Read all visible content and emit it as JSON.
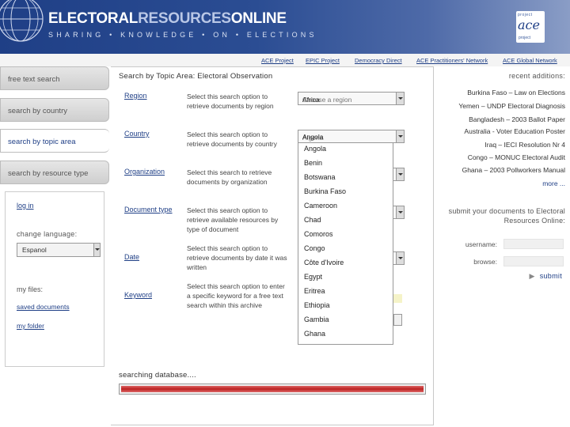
{
  "header": {
    "brand_part1": "ELECTORAL",
    "brand_part2": "RESOURCES",
    "brand_part3": "ONLINE",
    "tagline": "SHARING  •  KNOWLEDGE  •  ON  •  ELECTIONS",
    "logo_line1": "project",
    "logo_main": "ace",
    "logo_line3": "project"
  },
  "top_links": [
    "ACE Project",
    "EPIC Project",
    "Democracy Direct",
    "ACE Practitioners' Network",
    "ACE Global Network"
  ],
  "sidebar": {
    "tabs": [
      "free text search",
      "search by country",
      "search by topic area",
      "search by resource type"
    ],
    "login": "log in",
    "change_language": "change language:",
    "language_value": "Espanol",
    "my_files": "my files:",
    "saved_documents": "saved documents",
    "my_folder": "my folder"
  },
  "main": {
    "title": "Search by Topic Area: Electoral Observation",
    "rows": [
      {
        "label": "Region",
        "desc": "Select this search option to retrieve documents by region",
        "select": "Choose a region",
        "select_overlay": "Africa"
      },
      {
        "label": "Country",
        "desc": "Select this search option to retrieve documents by country",
        "select": "Algeria",
        "select_overlay": "Angola"
      },
      {
        "label": "Organization",
        "desc": "Select this search to retrieve documents by organization",
        "select": ""
      },
      {
        "label": "Document type",
        "desc": "Select this search option to retrieve available resources by type of document",
        "select": ""
      },
      {
        "label": "Date",
        "desc": "Select this search option to retrieve documents by date it was written",
        "select": ""
      },
      {
        "label": "Keyword",
        "desc": "Select this search option to enter a specific keyword for a free text search within this archive",
        "select": ""
      }
    ],
    "dropdown_options": [
      "Angola",
      "Benin",
      "Botswana",
      "Burkina Faso",
      "Cameroon",
      "Chad",
      "Comoros",
      "Congo",
      "Côte d'Ivoire",
      "Egypt",
      "Eritrea",
      "Ethiopia",
      "Gambia",
      "Ghana"
    ],
    "searching": "searching database....",
    "progress": 1.0
  },
  "right": {
    "recent_header": "recent additions:",
    "recent": [
      "Burkina Faso – Law on Elections",
      "Yemen – UNDP Electoral Diagnosis",
      "Bangladesh – 2003 Ballot Paper",
      "Australia - Voter Education Poster",
      "Iraq – IECI Resolution Nr 4",
      "Congo – MONUC Electoral Audit",
      "Ghana – 2003 Pollworkers Manual"
    ],
    "more": "more ...",
    "submit_header": "submit your documents to Electoral Resources Online:",
    "username_label": "username:",
    "browse_label": "browse:",
    "submit_label": "submit"
  },
  "colors": {
    "brand_blue": "#1f3f86",
    "progress_red": "#b22222"
  }
}
